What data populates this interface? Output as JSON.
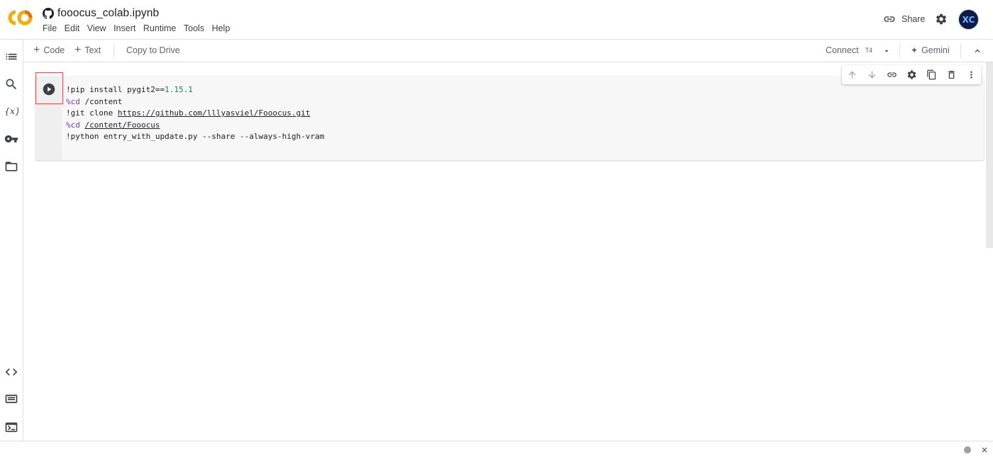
{
  "app": {
    "logo": "CO",
    "logo_colors": [
      "#f9ab00",
      "#e8710a"
    ]
  },
  "header": {
    "github_icon": "github-icon",
    "title": "fooocus_colab.ipynb",
    "share_label": "Share",
    "avatar_text": "XC"
  },
  "menu": [
    "File",
    "Edit",
    "View",
    "Insert",
    "Runtime",
    "Tools",
    "Help"
  ],
  "toolbar": {
    "add_code": "Code",
    "add_text": "Text",
    "copy_to_drive": "Copy to Drive",
    "connect": "Connect",
    "runtime_type": "T4",
    "gemini": "Gemini"
  },
  "rail_icons": [
    "toc-icon",
    "search-icon",
    "variables-icon",
    "secrets-key-icon",
    "folder-icon",
    "code-snippets-icon",
    "command-palette-icon",
    "terminal-icon"
  ],
  "cell_toolbar_icons": [
    "move-up-icon",
    "move-down-icon",
    "link-icon",
    "settings-icon",
    "mirror-cell-icon",
    "delete-icon",
    "more-vert-icon"
  ],
  "cell": {
    "lines": [
      {
        "parts": [
          {
            "t": "!pip install pygit2==",
            "c": ""
          },
          {
            "t": "1.15.1",
            "c": "num"
          }
        ]
      },
      {
        "parts": [
          {
            "t": "%cd",
            "c": "kw"
          },
          {
            "t": " /content",
            "c": ""
          }
        ]
      },
      {
        "parts": [
          {
            "t": "!git clone ",
            "c": ""
          },
          {
            "t": "https://github.com/lllyasviel/Fooocus.git",
            "c": "ul"
          }
        ]
      },
      {
        "parts": [
          {
            "t": "%cd",
            "c": "kw"
          },
          {
            "t": " ",
            "c": ""
          },
          {
            "t": "/content/Fooocus",
            "c": "ul"
          }
        ]
      },
      {
        "parts": [
          {
            "t": "!python entry_with_update.py --share --always-high-vram",
            "c": ""
          }
        ]
      }
    ]
  },
  "colors": {
    "accent_red": "#e05050",
    "keyword": "#7b38c6",
    "number": "#098658"
  }
}
